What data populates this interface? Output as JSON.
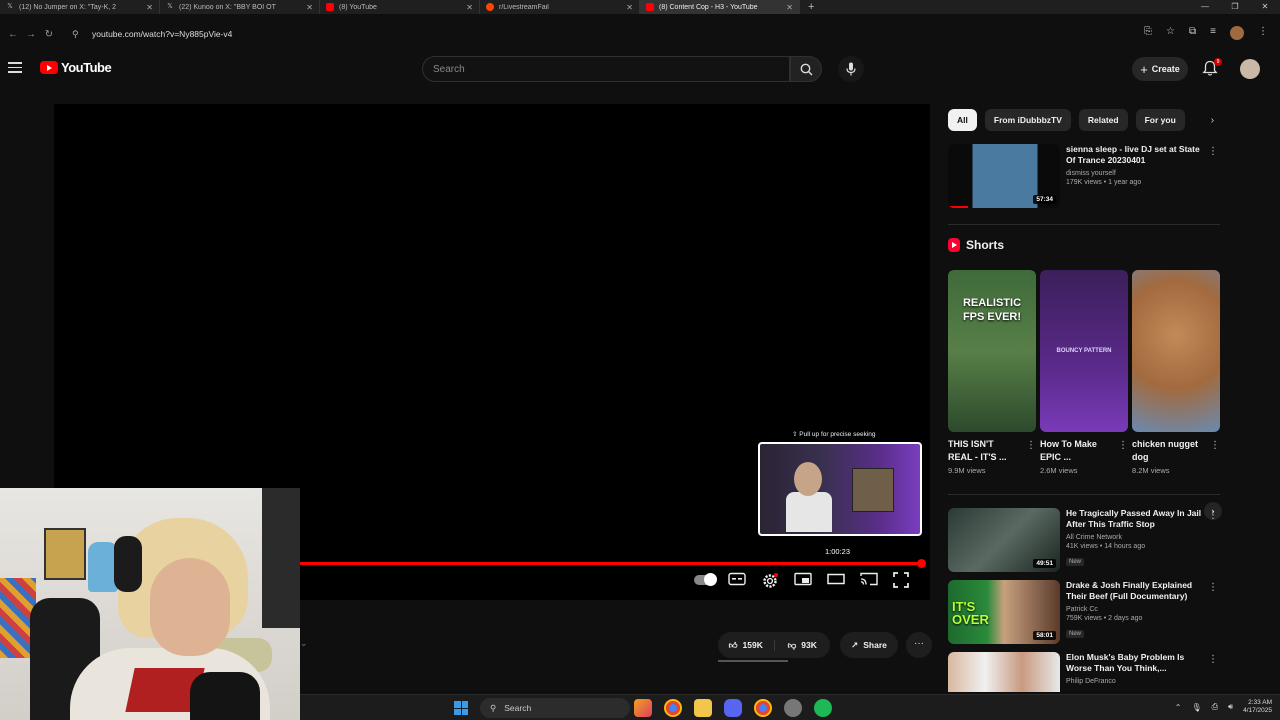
{
  "browser": {
    "tabs": [
      {
        "label": "(12) No Jumper on X: \"Tay-K, 2",
        "icon": "x-logo-icon",
        "active": false
      },
      {
        "label": "(22) Kunoo on X: \"BBY BOI OT",
        "icon": "x-logo-icon",
        "active": false
      },
      {
        "label": "(8) YouTube",
        "icon": "youtube-icon",
        "active": false
      },
      {
        "label": "r/LivestreamFail",
        "icon": "reddit-icon",
        "active": false
      },
      {
        "label": "(8) Content Cop - H3 - YouTube",
        "icon": "youtube-icon",
        "active": true
      }
    ],
    "new_tab_symbol": "+",
    "url": "youtube.com/watch?v=Ny885pVie-v4"
  },
  "header": {
    "logo_text": "YouTube",
    "search_placeholder": "Search",
    "create_label": "Create",
    "notification_count": "9"
  },
  "player": {
    "seek_hint": "Pull up for precise seeking",
    "hover_time": "1:00:23",
    "progress_fraction": 0.995
  },
  "actions": {
    "likes": "159K",
    "dislikes": "93K",
    "share_label": "Share"
  },
  "sidebar": {
    "chips": [
      {
        "label": "All",
        "active": true
      },
      {
        "label": "From iDubbbzTV",
        "active": false
      },
      {
        "label": "Related",
        "active": false
      },
      {
        "label": "For you",
        "active": false
      }
    ],
    "top_video": {
      "title": "sienna sleep - live DJ set at State Of Trance 20230401",
      "channel": "dismiss yourself",
      "meta": "179K views • 1 year ago",
      "duration": "57:34"
    },
    "shorts_heading": "Shorts",
    "shorts": [
      {
        "title": "THIS ISN'T REAL - IT'S ...",
        "views": "9.9M views",
        "overlay": "REALISTIC FPS EVER!"
      },
      {
        "title": "How To Make EPIC ...",
        "views": "2.6M views",
        "overlay": "BOUNCY PATTERN"
      },
      {
        "title": "chicken nugget dog",
        "views": "8.2M views",
        "overlay": ""
      }
    ],
    "videos": [
      {
        "title": "He Tragically Passed Away In Jail After This Traffic Stop",
        "channel": "All Crime Network",
        "meta": "41K views • 14 hours ago",
        "badge": "New",
        "duration": "49:51"
      },
      {
        "title": "Drake & Josh Finally Explained Their Beef (Full Documentary)",
        "channel": "Patrick Cc",
        "meta": "759K views • 2 days ago",
        "badge": "New",
        "duration": "58:01",
        "overlay": "IT'S OVER"
      },
      {
        "title": "Elon Musk's Baby Problem Is Worse Than You Think,...",
        "channel": "Philip DeFranco",
        "meta": "",
        "badge": "",
        "duration": ""
      }
    ]
  },
  "taskbar": {
    "search_label": "Search",
    "time": "2:33 AM",
    "date": "4/17/2025"
  },
  "colors": {
    "background": "#0f0f0f",
    "accent_red": "#ff0000",
    "chip_bg": "#272727"
  }
}
